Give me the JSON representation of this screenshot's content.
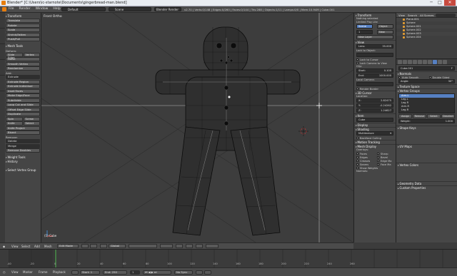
{
  "window": {
    "title": "Blender* [C:\\Users\\ic-starnote\\Documents\\gingerbread-man.blend]",
    "minimize": "─",
    "maximize": "□",
    "close": "✕"
  },
  "info_header": {
    "menus": [
      "File",
      "Render",
      "Window",
      "Help"
    ],
    "layout": "Default",
    "scene": "Scene",
    "engine": "Blender Render",
    "stats": "v2.70 | Verts:0/148 | Edges:0/260 | Faces:0/144 | Tris:288 | Objects:1/11 | Lamps:0/0 | Mem:10.94M | Cube.001"
  },
  "toolshelf": {
    "transform_header": "Transform",
    "transform": [
      "Translate",
      "Rotate",
      "Scale",
      "Shrink/Fatten",
      "Push/Pull"
    ],
    "mesh_tools_header": "Mesh Tools",
    "deform_label": "Deform:",
    "deform": [
      "Slide Edge",
      "Vertex",
      "Noise",
      "Smooth Vertex",
      "Randomize"
    ],
    "add_label": "Add:",
    "extrude": "Extrude",
    "add": [
      "Extrude Region",
      "Extrude Individual",
      "Inset Faces",
      "Make Edge/Face",
      "Subdivide",
      "Loop Cut and Slide",
      "Offset Edge Slide",
      "Duplicate"
    ],
    "spin": "Spin",
    "screw": "Screw",
    "knife": "Knife",
    "select": "Select",
    "after_knife": [
      "Knife Project",
      "Bisect"
    ],
    "remove_label": "Remove:",
    "delete": "Delete",
    "merge": "Merge",
    "remove_doubles": "Remove Doubles",
    "weight_tools": "Weight Tools",
    "history": "History",
    "select_vgroup": "Select Vertex Group"
  },
  "viewport": {
    "label": "Front Ortho",
    "object_name": "(1) Cube"
  },
  "properties": {
    "transform_header": "Transform",
    "nothing_selected": "Nothing selected",
    "limited_label": "Limited Play Lite",
    "scene_btn": "Scene",
    "object_btn": "Object",
    "layer_num": "1",
    "new_btn": "New",
    "new_layer": "New Layer",
    "view_header": "View",
    "lens_label": "Lens:",
    "lens_value": "35.000",
    "lock_object_label": "Lock to Object:",
    "lock_cursor": "Lock to Cursor",
    "lock_camera": "Lock Camera to View",
    "clip_label": "Clip:",
    "clip_start_label": "Start:",
    "clip_start": "0.100",
    "clip_end_label": "End:",
    "clip_end": "1000.000",
    "local_camera": "Local Camera:",
    "render_border": "Render Border",
    "cursor_header": "3D Cursor",
    "location_label": "Location:",
    "cursor_x_label": "X:",
    "cursor_x": "2.82475",
    "cursor_y_label": "Y:",
    "cursor_y": "-0.24262",
    "cursor_z_label": "Z:",
    "cursor_z": "1.24627",
    "item_header": "Item",
    "item_name": "Cube",
    "display_header": "Display",
    "shading_header": "Shading",
    "shading_mode": "Multitexture",
    "backface": "Backface Culling",
    "motion_tracking": "Motion Tracking",
    "mesh_display_header": "Mesh Display",
    "overlays_label": "Overlays:",
    "overlays": [
      "Faces",
      "Sharp",
      "Edges",
      "Bevel",
      "Creases",
      "Edge Ma",
      "Seams",
      "Face Ma"
    ],
    "show_weights": "Show Weights",
    "normals_label": "Normals:"
  },
  "outliner": {
    "menus": [
      "View",
      "Search",
      "All Scenes"
    ],
    "search_placeholder": "",
    "items": [
      "Plane.001",
      "Sphere",
      "Sphere.001",
      "Sphere.002",
      "Sphere.003",
      "Sphere.004"
    ]
  },
  "data_props": {
    "object_name": "Cube.001",
    "normals_header": "Normals",
    "auto_smooth": "Auto Smooth",
    "double_sided": "Double Sided",
    "angle_label": "Angle:",
    "angle_value": "30°",
    "texture_space": "Texture Space",
    "vertex_groups": "Vertex Groups",
    "vgroups": [
      "Arm.L",
      "Leg.L",
      "Leg.R",
      "Arm.R",
      "Leg.R"
    ],
    "vg_buttons": [
      "Assign",
      "Remove",
      "Select",
      "Deselect"
    ],
    "weight_label": "Weight:",
    "weight_value": "1.000",
    "shape_keys": "Shape Keys",
    "uv_maps": "UV Maps",
    "vertex_colors": "Vertex Colors",
    "geometry_data": "Geometry Data",
    "custom_props": "Custom Properties"
  },
  "view3d_header": {
    "menus": [
      "View",
      "Select",
      "Add",
      "Mesh"
    ],
    "mode": "Edit Mode",
    "pivot": "Global"
  },
  "timeline": {
    "numbers": [
      "-40",
      "-20",
      "0",
      "20",
      "40",
      "60",
      "80",
      "100",
      "120",
      "140",
      "160",
      "180",
      "200",
      "220",
      "240",
      "260"
    ],
    "menus": [
      "View",
      "Marker",
      "Frame",
      "Playback"
    ],
    "start_label": "Start:",
    "start": "1",
    "end_label": "End:",
    "end": "250",
    "current": "1",
    "sync": "No Sync"
  }
}
